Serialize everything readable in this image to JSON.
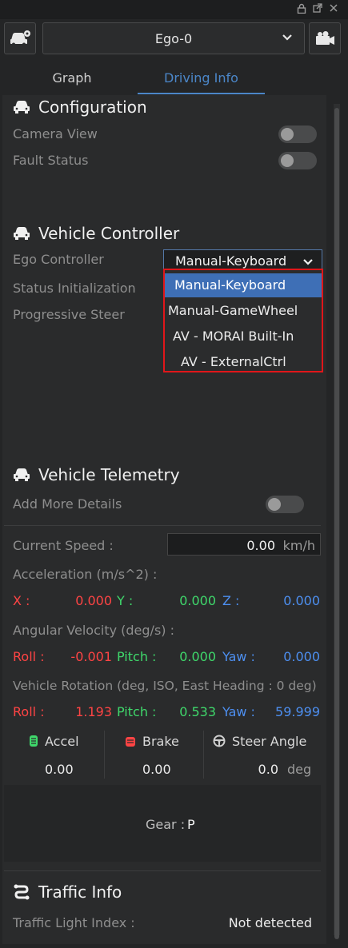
{
  "vehicle_bar": {
    "selected_vehicle": "Ego-0"
  },
  "tabs": [
    {
      "label": "Graph"
    },
    {
      "label": "Driving Info"
    }
  ],
  "configuration": {
    "title": "Configuration",
    "camera_view_label": "Camera View",
    "camera_view_on": false,
    "fault_status_label": "Fault Status",
    "fault_status_on": false
  },
  "vehicle_controller": {
    "title": "Vehicle Controller",
    "ego_controller_label": "Ego Controller",
    "ego_controller_value": "Manual-Keyboard",
    "status_init_label": "Status Initialization",
    "progressive_steer_label": "Progressive Steer",
    "options": [
      "Manual-Keyboard",
      "Manual-GameWheel",
      "AV - MORAI Built-In",
      "AV - ExternalCtrl"
    ]
  },
  "telemetry": {
    "title": "Vehicle Telemetry",
    "add_more_details_label": "Add More Details",
    "add_more_details_on": false,
    "current_speed_label": "Current Speed :",
    "current_speed_value": "0.00",
    "current_speed_unit": "km/h",
    "acceleration_label": "Acceleration (m/s^2) :",
    "acc_x_label": "X :",
    "acc_x": "0.000",
    "acc_y_label": "Y :",
    "acc_y": "0.000",
    "acc_z_label": "Z :",
    "acc_z": "0.000",
    "angular_label": "Angular Velocity (deg/s) :",
    "ang_roll_label": "Roll :",
    "ang_roll": "-0.001",
    "ang_pitch_label": "Pitch :",
    "ang_pitch": "0.000",
    "ang_yaw_label": "Yaw :",
    "ang_yaw": "0.000",
    "rotation_label": "Vehicle Rotation (deg, ISO, East Heading : 0 deg)",
    "rot_roll_label": "Roll :",
    "rot_roll": "1.193",
    "rot_pitch_label": "Pitch :",
    "rot_pitch": "0.533",
    "rot_yaw_label": "Yaw :",
    "rot_yaw": "59.999",
    "accel_label": "Accel",
    "accel_value": "0.00",
    "brake_label": "Brake",
    "brake_value": "0.00",
    "steer_label": "Steer Angle",
    "steer_value": "0.0",
    "steer_unit": "deg",
    "gear_label": "Gear :",
    "gear_value": "P"
  },
  "traffic": {
    "title": "Traffic Info",
    "light_index_label": "Traffic Light Index :",
    "light_index_value": "Not detected"
  },
  "colors": {
    "accent": "#4b86c8",
    "highlight_border": "#e0161a",
    "selected_item": "#3e6fb6",
    "red_value": "#ff4444",
    "green_value": "#3fd86b",
    "blue_value": "#4d8ff0"
  }
}
